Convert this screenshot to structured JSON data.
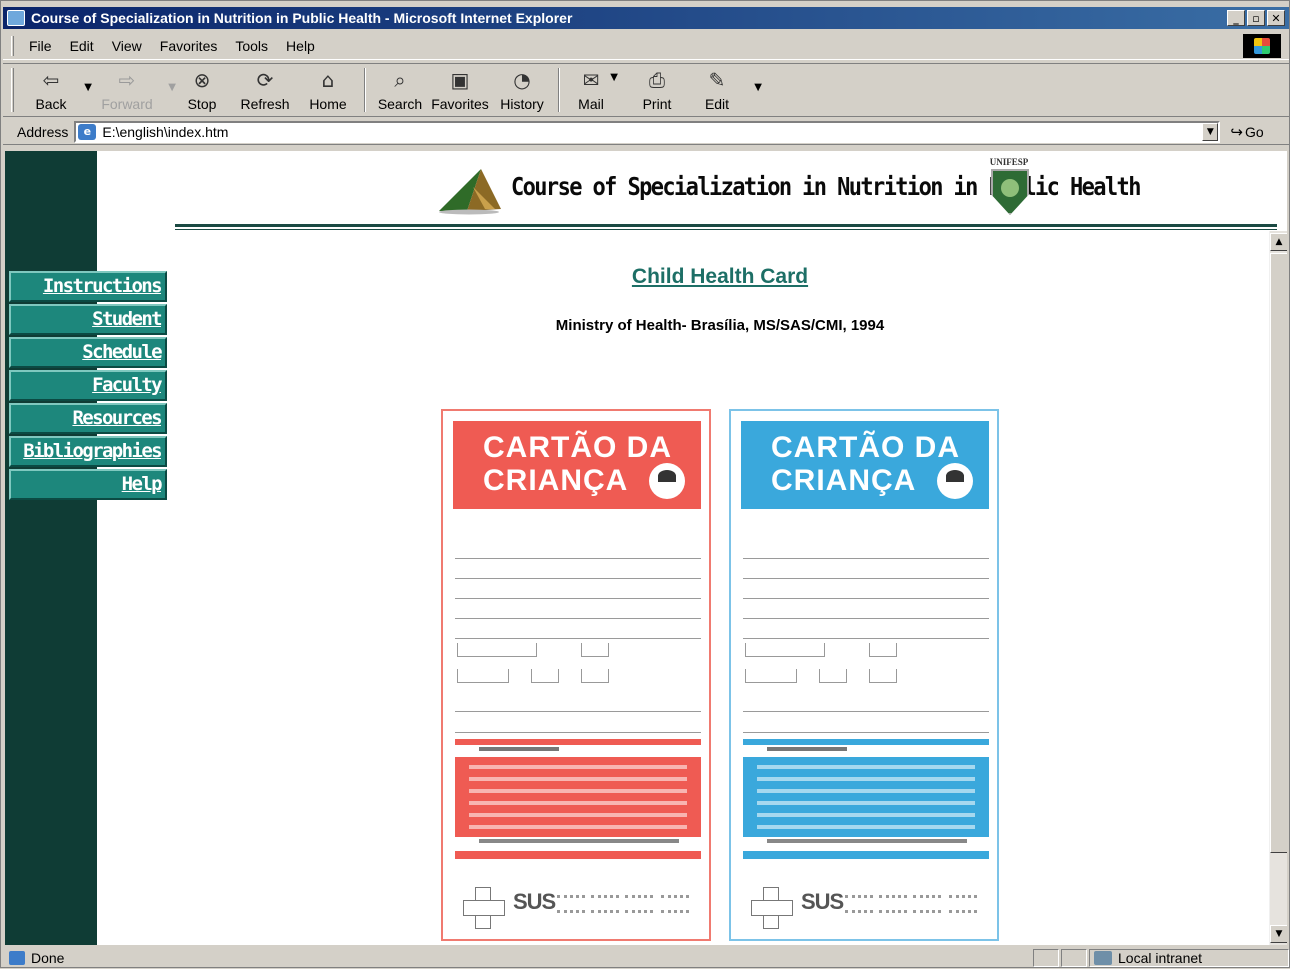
{
  "window": {
    "title": "Course of Specialization in Nutrition in Public Health - Microsoft Internet Explorer",
    "buttons": {
      "minimize": "_",
      "maximize": "▫",
      "close": "✕"
    }
  },
  "menu": [
    "File",
    "Edit",
    "View",
    "Favorites",
    "Tools",
    "Help"
  ],
  "toolbar": [
    {
      "label": "Back",
      "icon": "back-arrow-icon",
      "glyph": "⇦",
      "has_dropdown": true,
      "enabled": true
    },
    {
      "label": "Forward",
      "icon": "forward-arrow-icon",
      "glyph": "⇨",
      "has_dropdown": true,
      "enabled": false
    },
    {
      "label": "Stop",
      "icon": "stop-icon",
      "glyph": "⊗",
      "enabled": true
    },
    {
      "label": "Refresh",
      "icon": "refresh-icon",
      "glyph": "⟳",
      "enabled": true
    },
    {
      "label": "Home",
      "icon": "home-icon",
      "glyph": "⌂",
      "enabled": true
    },
    {
      "label": "Search",
      "icon": "search-icon",
      "glyph": "⌕",
      "enabled": true
    },
    {
      "label": "Favorites",
      "icon": "favorites-folder-icon",
      "glyph": "▣",
      "enabled": true
    },
    {
      "label": "History",
      "icon": "history-icon",
      "glyph": "◔",
      "enabled": true
    },
    {
      "label": "Mail",
      "icon": "mail-icon",
      "glyph": "✉",
      "has_dropdown": true,
      "enabled": true
    },
    {
      "label": "Print",
      "icon": "print-icon",
      "glyph": "⎙",
      "enabled": true
    },
    {
      "label": "Edit",
      "icon": "edit-icon",
      "glyph": "✎",
      "has_dropdown": true,
      "enabled": true
    }
  ],
  "address": {
    "label": "Address",
    "value": "E:\\english\\index.htm",
    "go_label": "Go"
  },
  "page": {
    "site_title": "Course of Specialization in Nutrition in Public Health",
    "badge_label": "UNIFESP",
    "nav": [
      "Instructions",
      "Student",
      "Schedule",
      "Faculty",
      "Resources",
      "Bibliographies",
      "Help"
    ],
    "content_title": "Child Health Card",
    "content_subtitle": "Ministry of Health- Brasília, MS/SAS/CMI, 1994",
    "cards": [
      {
        "color": "#ef5b53",
        "heading_line1": "CARTÃO DA",
        "heading_line2": "CRIANÇA",
        "brand": "SUS"
      },
      {
        "color": "#3aa8dc",
        "heading_line1": "CARTÃO DA",
        "heading_line2": "CRIANÇA",
        "brand": "SUS"
      }
    ]
  },
  "status": {
    "text": "Done",
    "zone": "Local intranet"
  }
}
